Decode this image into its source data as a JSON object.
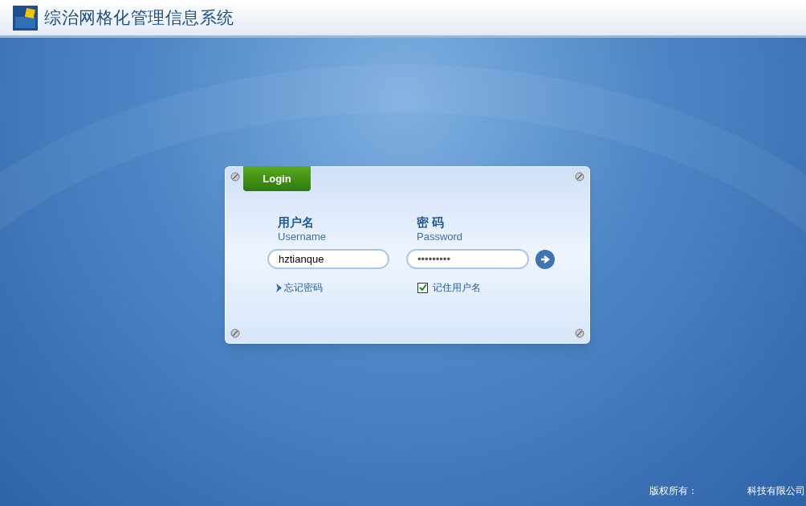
{
  "header": {
    "title": "综治网格化管理信息系统"
  },
  "login": {
    "tab": "Login",
    "username": {
      "label": "用户名",
      "sublabel": "Username",
      "value": "hztianque"
    },
    "password": {
      "label": "密 码",
      "sublabel": "Password",
      "value": "•••••••••"
    },
    "forgot_link": "忘记密码",
    "remember": {
      "label": "记住用户名",
      "checked": true
    }
  },
  "footer": {
    "copyright": "版权所有：",
    "company": "科技有限公司"
  }
}
